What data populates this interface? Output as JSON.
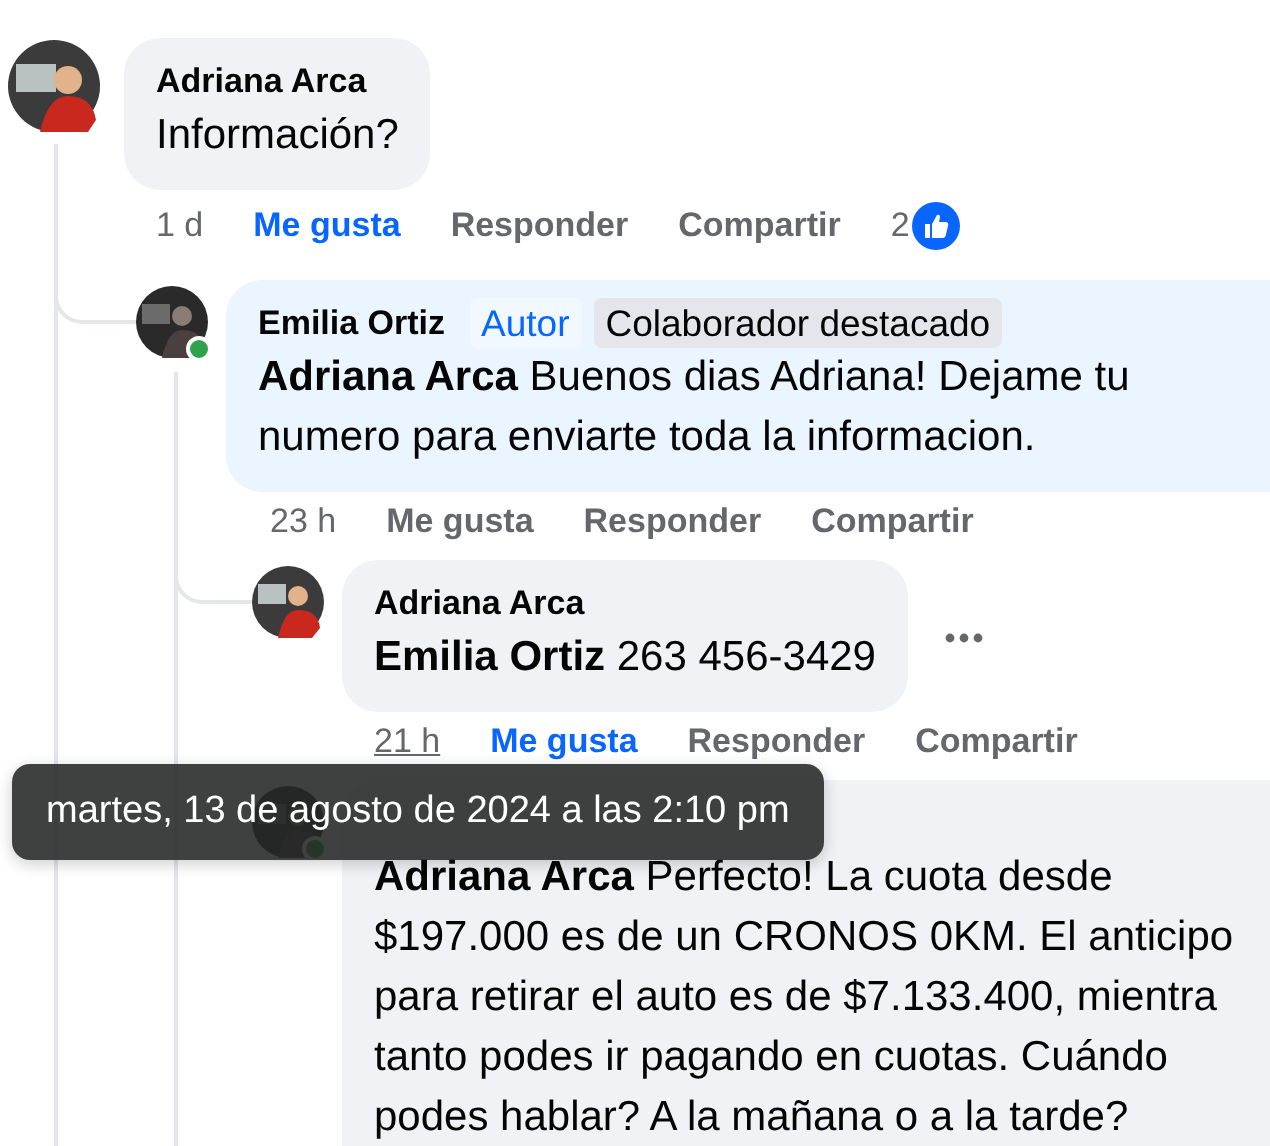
{
  "comments": [
    {
      "author": "Adriana Arca",
      "lines": [
        "Información?"
      ],
      "time": "1 d",
      "time_hover": false,
      "like": "Me gusta",
      "liked": true,
      "reply": "Responder",
      "share": "Compartir",
      "reactions": "2",
      "children": [
        {
          "author": "Emilia Ortiz",
          "online": true,
          "badges": [
            {
              "label": "Autor",
              "kind": "author"
            },
            {
              "label": "Colaborador destacado",
              "kind": "top"
            }
          ],
          "lines": [
            "**Adriana Arca** Buenos dias Adriana! Dejame tu",
            "numero para enviarte toda la informacion."
          ],
          "time": "23 h",
          "time_hover": false,
          "like": "Me gusta",
          "liked": false,
          "reply": "Responder",
          "share": "Compartir",
          "children": [
            {
              "author": "Adriana Arca",
              "lines": [
                "**Emilia Ortiz** 263 456-3429"
              ],
              "time": "21 h",
              "time_hover": true,
              "like": "Me gusta",
              "liked": true,
              "reply": "Responder",
              "share": "Compartir",
              "more": true
            },
            {
              "online": true,
              "lines": [
                "**Adriana Arca** Perfecto! La cuota desde",
                "$197.000 es de un CRONOS 0KM. El anticipo",
                "para retirar el auto es de $7.133.400, mientra",
                "tanto podes ir pagando en cuotas. Cuándo",
                "podes hablar? A la mañana o a la tarde?"
              ]
            }
          ]
        }
      ]
    }
  ],
  "tooltip": "martes, 13 de agosto de 2024 a las 2:10 pm"
}
